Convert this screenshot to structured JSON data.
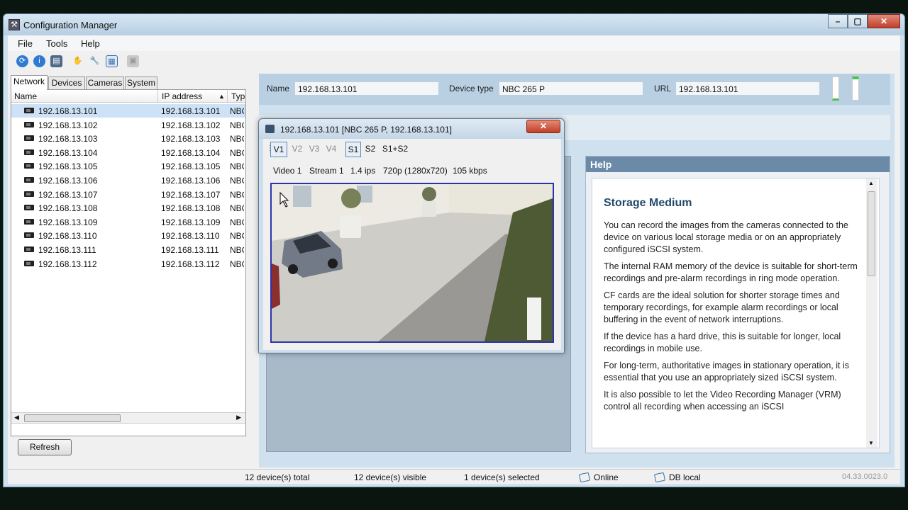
{
  "window": {
    "title": "Configuration Manager"
  },
  "menu": [
    "File",
    "Tools",
    "Help"
  ],
  "toolbar_icons": [
    "scan-icon",
    "info-icon",
    "save-icon",
    "hand-icon",
    "wrench-icon",
    "table-icon",
    "disk-icon"
  ],
  "tabs": [
    "Network",
    "Devices",
    "Cameras",
    "System"
  ],
  "device_list": {
    "columns": [
      "Name",
      "IP address",
      "Typ"
    ],
    "rows": [
      {
        "name": "192.168.13.101",
        "ip": "192.168.13.101",
        "type": "NBC"
      },
      {
        "name": "192.168.13.102",
        "ip": "192.168.13.102",
        "type": "NBC"
      },
      {
        "name": "192.168.13.103",
        "ip": "192.168.13.103",
        "type": "NBC"
      },
      {
        "name": "192.168.13.104",
        "ip": "192.168.13.104",
        "type": "NBC"
      },
      {
        "name": "192.168.13.105",
        "ip": "192.168.13.105",
        "type": "NBC"
      },
      {
        "name": "192.168.13.106",
        "ip": "192.168.13.106",
        "type": "NBC"
      },
      {
        "name": "192.168.13.107",
        "ip": "192.168.13.107",
        "type": "NBC"
      },
      {
        "name": "192.168.13.108",
        "ip": "192.168.13.108",
        "type": "NBC"
      },
      {
        "name": "192.168.13.109",
        "ip": "192.168.13.109",
        "type": "NBC"
      },
      {
        "name": "192.168.13.110",
        "ip": "192.168.13.110",
        "type": "NBC"
      },
      {
        "name": "192.168.13.111",
        "ip": "192.168.13.111",
        "type": "NBC"
      },
      {
        "name": "192.168.13.112",
        "ip": "192.168.13.112",
        "type": "NBC"
      }
    ]
  },
  "refresh_label": "Refresh",
  "info": {
    "name_label": "Name",
    "name_value": "192.168.13.101",
    "type_label": "Device type",
    "type_value": "NBC 265 P",
    "url_label": "URL",
    "url_value": "192.168.13.101"
  },
  "help": {
    "header": "Help",
    "title": "Storage Medium",
    "paragraphs": [
      "You can record the images from the cameras connected to the device on various local storage media or on an appropriately configured iSCSI system.",
      "The internal RAM memory of the device is suitable for short-term recordings and pre-alarm recordings in ring mode operation.",
      "CF cards are the ideal solution for shorter storage times and temporary recordings, for example alarm recordings or local buffering in the event of network interruptions.",
      "If the device has a hard drive, this is suitable for longer, local recordings in mobile use.",
      "For long-term, authoritative images in stationary operation, it is essential that you use an appropriately sized iSCSI system.",
      "It is also possible to let the Video Recording Manager (VRM) control all recording when accessing an iSCSI"
    ]
  },
  "popup": {
    "title": "192.168.13.101 [NBC 265 P, 192.168.13.101]",
    "video_buttons": [
      "V1",
      "V2",
      "V3",
      "V4"
    ],
    "stream_buttons": [
      "S1",
      "S2",
      "S1+S2"
    ],
    "video_info": [
      "Video 1",
      "Stream 1",
      "1.4 ips",
      "720p (1280x720)",
      "105 kbps"
    ]
  },
  "status": {
    "total": "12 device(s) total",
    "visible": "12 device(s) visible",
    "selected": "1 device(s) selected",
    "online": "Online",
    "db": "DB local",
    "version": "04.33.0023.0"
  }
}
